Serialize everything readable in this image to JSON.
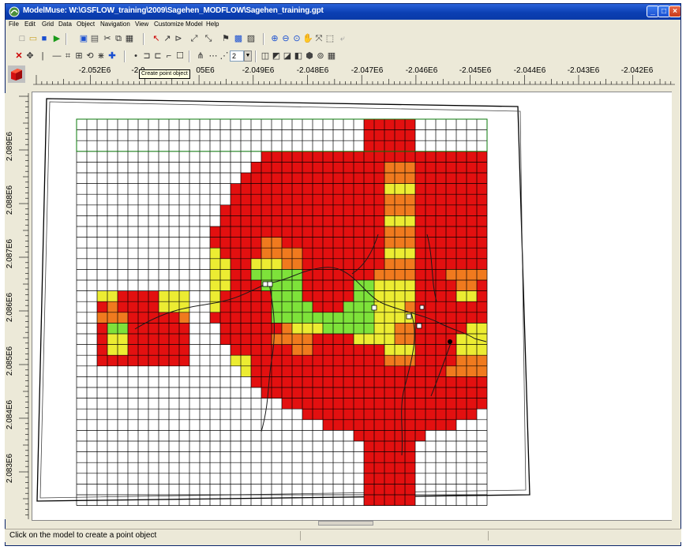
{
  "window": {
    "title": "ModelMuse: W:\\GSFLOW_training\\2009\\Sagehen_MODFLOW\\Sagehen_training.gpt"
  },
  "menu": [
    "File",
    "Edit",
    "Grid",
    "Data",
    "Object",
    "Navigation",
    "View",
    "Customize",
    "Model",
    "Help"
  ],
  "toolbar": {
    "spin_value": "2"
  },
  "tooltip": "Create point object",
  "ruler": {
    "x_labels": [
      "-2.052E6",
      "-2.0",
      "05E6",
      "-2.049E6",
      "-2.048E6",
      "-2.047E6",
      "-2.046E6",
      "-2.045E6",
      "-2.044E6",
      "-2.043E6",
      "-2.042E6"
    ],
    "y_labels": [
      "2.089E6",
      "2.088E6",
      "2.087E6",
      "2.086E6",
      "2.085E6",
      "2.084E6",
      "2.083E6"
    ]
  },
  "status": {
    "message": "Click on the model to create a point object"
  },
  "colors": {
    "high": "#e31010",
    "medium": "#f07a1e",
    "low": "#ecec32",
    "lowest": "#7ee23a",
    "grid_line": "#000000",
    "boundary": "#0a7a0a"
  }
}
